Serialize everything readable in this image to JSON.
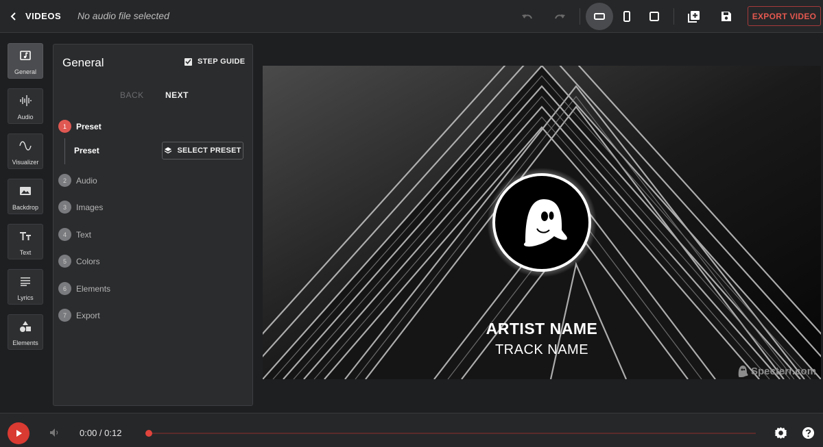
{
  "header": {
    "back_label": "VIDEOS",
    "audio_status": "No audio file selected",
    "export_label": "EXPORT VIDEO",
    "accent_color": "#e4584f"
  },
  "sidebar": {
    "items": [
      {
        "label": "General",
        "icon": "music-note-icon",
        "active": true
      },
      {
        "label": "Audio",
        "icon": "waveform-icon"
      },
      {
        "label": "Visualizer",
        "icon": "sine-wave-icon"
      },
      {
        "label": "Backdrop",
        "icon": "image-icon"
      },
      {
        "label": "Text",
        "icon": "text-icon"
      },
      {
        "label": "Lyrics",
        "icon": "lines-icon"
      },
      {
        "label": "Elements",
        "icon": "shapes-icon"
      }
    ]
  },
  "panel": {
    "title": "General",
    "step_guide_label": "STEP GUIDE",
    "step_guide_checked": true,
    "back_label": "BACK",
    "next_label": "NEXT",
    "steps": [
      {
        "num": "1",
        "label": "Preset",
        "active": true
      },
      {
        "num": "2",
        "label": "Audio"
      },
      {
        "num": "3",
        "label": "Images"
      },
      {
        "num": "4",
        "label": "Text"
      },
      {
        "num": "5",
        "label": "Colors"
      },
      {
        "num": "6",
        "label": "Elements"
      },
      {
        "num": "7",
        "label": "Export"
      }
    ],
    "sub_label": "Preset",
    "select_preset_label": "SELECT PRESET"
  },
  "preview": {
    "artist_name": "ARTIST NAME",
    "track_name": "TRACK NAME",
    "watermark": "Specterr.com"
  },
  "player": {
    "time": "0:00 / 0:12",
    "progress": 0
  }
}
